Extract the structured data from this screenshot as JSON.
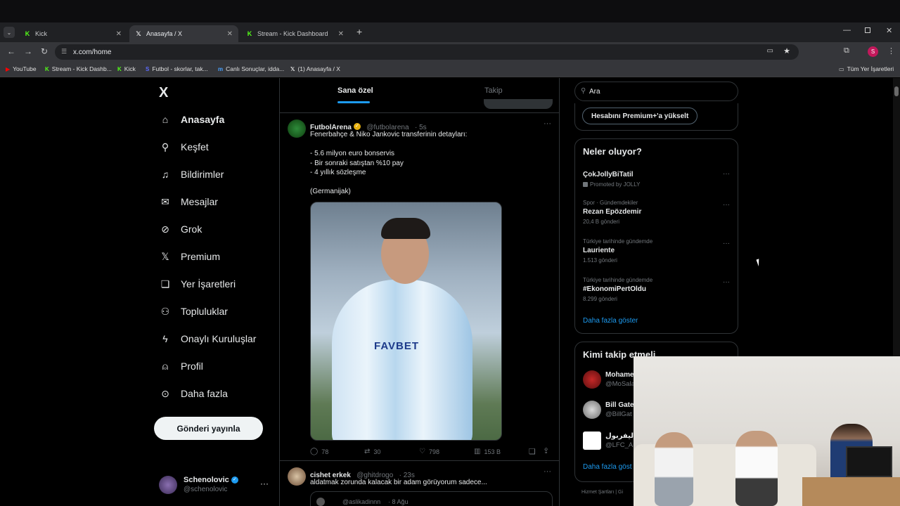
{
  "browser": {
    "tabs": [
      {
        "title": "Kick",
        "icon": "kick-icon"
      },
      {
        "title": "Anasayfa / X",
        "icon": "x-icon"
      },
      {
        "title": "Stream - Kick Dashboard",
        "icon": "kick-icon"
      }
    ],
    "new_tab": "+",
    "url": "x.com/home",
    "profile_initial": "S",
    "bookmarks": [
      {
        "label": "YouTube",
        "icon": "youtube-icon"
      },
      {
        "label": "Stream - Kick Dashb...",
        "icon": "kick-icon"
      },
      {
        "label": "Kick",
        "icon": "kick-icon"
      },
      {
        "label": "Futbol - skorlar, tak...",
        "icon": "sofascore-icon"
      },
      {
        "label": "Canlı Sonuçlar, idda...",
        "icon": "mackolik-icon"
      },
      {
        "label": "(1) Anasayfa / X",
        "icon": "x-icon"
      }
    ],
    "all_bookmarks": "Tüm Yer İşaretleri",
    "colors": {
      "kick": "#53fc18",
      "accent": "#1d9bf0"
    }
  },
  "sidebar": {
    "logo": "X",
    "items": [
      {
        "label": "Anasayfa",
        "icon": "home-icon"
      },
      {
        "label": "Keşfet",
        "icon": "search-icon"
      },
      {
        "label": "Bildirimler",
        "icon": "bell-icon"
      },
      {
        "label": "Mesajlar",
        "icon": "envelope-icon"
      },
      {
        "label": "Grok",
        "icon": "grok-icon"
      },
      {
        "label": "Premium",
        "icon": "x-icon"
      },
      {
        "label": "Yer İşaretleri",
        "icon": "bookmark-icon"
      },
      {
        "label": "Topluluklar",
        "icon": "people-icon"
      },
      {
        "label": "Onaylı Kuruluşlar",
        "icon": "lightning-icon"
      },
      {
        "label": "Profil",
        "icon": "person-icon"
      },
      {
        "label": "Daha fazla",
        "icon": "more-circle-icon"
      }
    ],
    "post_button": "Gönderi yayınla",
    "account": {
      "name": "Schenolovic",
      "handle": "@schenolovic",
      "more": "···"
    }
  },
  "feed": {
    "tabs": [
      "Sana özel",
      "Takip"
    ],
    "tweets": [
      {
        "name": "FutbolArena",
        "handle": "@futbolarena",
        "time": "· 5s",
        "text": "Fenerbahçe & Niko Jankovic transferinin detayları:\n\n- 5.6 milyon euro bonservis\n- Bir sonraki satıştan %10 pay\n- 4 yıllık sözleşme\n\n(Germanijak)",
        "jersey_text": "FAVBET",
        "replies": "78",
        "retweets": "30",
        "likes": "798",
        "views": "153 B"
      },
      {
        "name": "cishet erkek",
        "handle": "@ghitdrogo",
        "time": "· 23s",
        "text": "aldatmak zorunda kalacak bir adam görüyorum sadece...",
        "quote_handle": "@aslikadinnn",
        "quote_time": "· 8 Ağu"
      }
    ],
    "more": "···"
  },
  "right": {
    "search_value": "Ara",
    "premium_button": "Hesabını Premium+'a yükselt",
    "trends_title": "Neler oluyor?",
    "trends": [
      {
        "category": "",
        "title": "ÇokJollyBiTatil",
        "count": "Promoted by JOLLY"
      },
      {
        "category": "Spor · Gündemdekiler",
        "title": "Rezan Epözdemir",
        "count": "20,4 B gönderi"
      },
      {
        "category": "Türkiye tarihinde gündemde",
        "title": "Lauriente",
        "count": "1.513 gönderi"
      },
      {
        "category": "Türkiye tarihinde gündemde",
        "title": "#EkonomiPertOldu",
        "count": "8.299 gönderi"
      }
    ],
    "show_more": "Daha fazla göster",
    "who_title": "Kimi takip etmeli",
    "who": [
      {
        "name": "Mohame",
        "handle": "@MoSala"
      },
      {
        "name": "Bill Gate",
        "handle": "@BillGat"
      },
      {
        "name": "ي ليفربول",
        "handle": "@LFC_Ara"
      }
    ],
    "who_show_more": "Daha fazla göst",
    "footer": "Hizmet Şartları  |  Gi"
  }
}
